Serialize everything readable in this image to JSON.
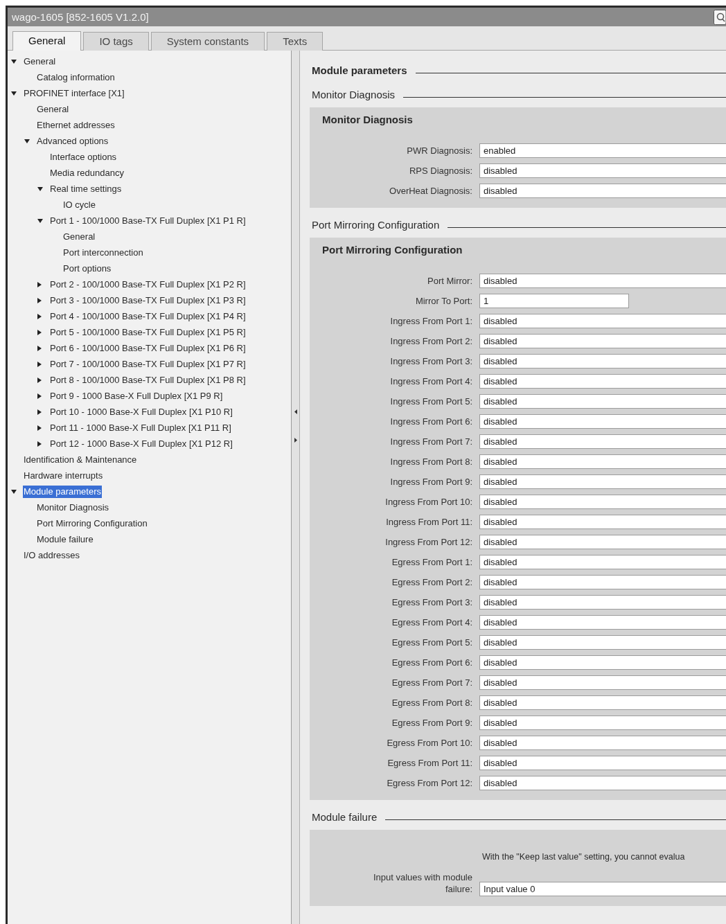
{
  "window": {
    "title": "wago-1605 [852-1605 V1.2.0]"
  },
  "tabs": [
    {
      "label": "General",
      "selected": true
    },
    {
      "label": "IO tags",
      "selected": false
    },
    {
      "label": "System constants",
      "selected": false
    },
    {
      "label": "Texts",
      "selected": false
    }
  ],
  "tree": [
    {
      "label": "General",
      "selected": false,
      "expanded": true,
      "children": [
        {
          "label": "Catalog information",
          "selected": false
        }
      ]
    },
    {
      "label": "PROFINET interface [X1]",
      "selected": false,
      "expanded": true,
      "children": [
        {
          "label": "General",
          "selected": false
        },
        {
          "label": "Ethernet addresses",
          "selected": false
        },
        {
          "label": "Advanced options",
          "selected": false,
          "expanded": true,
          "children": [
            {
              "label": "Interface options",
              "selected": false
            },
            {
              "label": "Media redundancy",
              "selected": false
            },
            {
              "label": "Real time settings",
              "selected": false,
              "expanded": true,
              "children": [
                {
                  "label": "IO cycle",
                  "selected": false
                }
              ]
            },
            {
              "label": "Port 1 - 100/1000 Base-TX Full Duplex [X1 P1 R]",
              "selected": false,
              "expanded": true,
              "children": [
                {
                  "label": "General",
                  "selected": false
                },
                {
                  "label": "Port interconnection",
                  "selected": false
                },
                {
                  "label": "Port options",
                  "selected": false
                }
              ]
            },
            {
              "label": "Port 2 - 100/1000 Base-TX Full Duplex [X1 P2 R]",
              "selected": false,
              "expanded": false
            },
            {
              "label": "Port 3 - 100/1000 Base-TX Full Duplex [X1 P3 R]",
              "selected": false,
              "expanded": false
            },
            {
              "label": "Port 4 - 100/1000 Base-TX Full Duplex [X1 P4 R]",
              "selected": false,
              "expanded": false
            },
            {
              "label": "Port 5 - 100/1000 Base-TX Full Duplex [X1 P5 R]",
              "selected": false,
              "expanded": false
            },
            {
              "label": "Port 6 - 100/1000 Base-TX Full Duplex [X1 P6 R]",
              "selected": false,
              "expanded": false
            },
            {
              "label": "Port 7 - 100/1000 Base-TX Full Duplex [X1 P7 R]",
              "selected": false,
              "expanded": false
            },
            {
              "label": "Port 8 - 100/1000 Base-TX Full Duplex [X1 P8 R]",
              "selected": false,
              "expanded": false
            },
            {
              "label": "Port 9 - 1000 Base-X Full Duplex [X1 P9 R]",
              "selected": false,
              "expanded": false
            },
            {
              "label": "Port 10 - 1000 Base-X Full Duplex [X1 P10 R]",
              "selected": false,
              "expanded": false
            },
            {
              "label": "Port 11 - 1000 Base-X Full Duplex [X1 P11 R]",
              "selected": false,
              "expanded": false
            },
            {
              "label": "Port 12 - 1000 Base-X Full Duplex [X1 P12 R]",
              "selected": false,
              "expanded": false
            }
          ]
        }
      ]
    },
    {
      "label": "Identification & Maintenance",
      "selected": false
    },
    {
      "label": "Hardware interrupts",
      "selected": false
    },
    {
      "label": "Module parameters",
      "selected": true,
      "expanded": true,
      "children": [
        {
          "label": "Monitor Diagnosis",
          "selected": false
        },
        {
          "label": "Port Mirroring Configuration",
          "selected": false
        },
        {
          "label": "Module failure",
          "selected": false
        }
      ]
    },
    {
      "label": "I/O addresses",
      "selected": false
    }
  ],
  "content": {
    "heading": "Module parameters",
    "sections": [
      {
        "heading": "Monitor Diagnosis",
        "panel_title": "Monitor Diagnosis",
        "fields": [
          {
            "label": "PWR Diagnosis:",
            "value": "enabled",
            "kind": "dropdown"
          },
          {
            "label": "RPS Diagnosis:",
            "value": "disabled",
            "kind": "dropdown"
          },
          {
            "label": "OverHeat Diagnosis:",
            "value": "disabled",
            "kind": "dropdown"
          }
        ]
      },
      {
        "heading": "Port Mirroring Configuration",
        "panel_title": "Port Mirroring Configuration",
        "fields": [
          {
            "label": "Port Mirror:",
            "value": "disabled",
            "kind": "dropdown"
          },
          {
            "label": "Mirror To Port:",
            "value": "1",
            "kind": "text"
          },
          {
            "label": "Ingress From Port 1:",
            "value": "disabled",
            "kind": "dropdown"
          },
          {
            "label": "Ingress From Port 2:",
            "value": "disabled",
            "kind": "dropdown"
          },
          {
            "label": "Ingress From Port 3:",
            "value": "disabled",
            "kind": "dropdown"
          },
          {
            "label": "Ingress From Port 4:",
            "value": "disabled",
            "kind": "dropdown"
          },
          {
            "label": "Ingress From Port 5:",
            "value": "disabled",
            "kind": "dropdown"
          },
          {
            "label": "Ingress From Port 6:",
            "value": "disabled",
            "kind": "dropdown"
          },
          {
            "label": "Ingress From Port 7:",
            "value": "disabled",
            "kind": "dropdown"
          },
          {
            "label": "Ingress From Port 8:",
            "value": "disabled",
            "kind": "dropdown"
          },
          {
            "label": "Ingress From Port 9:",
            "value": "disabled",
            "kind": "dropdown"
          },
          {
            "label": "Ingress From Port 10:",
            "value": "disabled",
            "kind": "dropdown"
          },
          {
            "label": "Ingress From Port 11:",
            "value": "disabled",
            "kind": "dropdown"
          },
          {
            "label": "Ingress From Port 12:",
            "value": "disabled",
            "kind": "dropdown"
          },
          {
            "label": "Egress From Port 1:",
            "value": "disabled",
            "kind": "dropdown"
          },
          {
            "label": "Egress From Port 2:",
            "value": "disabled",
            "kind": "dropdown"
          },
          {
            "label": "Egress From Port 3:",
            "value": "disabled",
            "kind": "dropdown"
          },
          {
            "label": "Egress From Port 4:",
            "value": "disabled",
            "kind": "dropdown"
          },
          {
            "label": "Egress From Port 5:",
            "value": "disabled",
            "kind": "dropdown"
          },
          {
            "label": "Egress From Port 6:",
            "value": "disabled",
            "kind": "dropdown"
          },
          {
            "label": "Egress From Port 7:",
            "value": "disabled",
            "kind": "dropdown"
          },
          {
            "label": "Egress From Port 8:",
            "value": "disabled",
            "kind": "dropdown"
          },
          {
            "label": "Egress From Port 9:",
            "value": "disabled",
            "kind": "dropdown"
          },
          {
            "label": "Egress From Port 10:",
            "value": "disabled",
            "kind": "dropdown"
          },
          {
            "label": "Egress From Port 11:",
            "value": "disabled",
            "kind": "dropdown"
          },
          {
            "label": "Egress From Port 12:",
            "value": "disabled",
            "kind": "dropdown"
          }
        ]
      },
      {
        "heading": "Module failure",
        "note": "With the \"Keep last value\" setting, you cannot evalua",
        "fields": [
          {
            "label": "Input values with module failure:",
            "value": "Input value 0",
            "kind": "dropdown"
          }
        ]
      }
    ]
  }
}
